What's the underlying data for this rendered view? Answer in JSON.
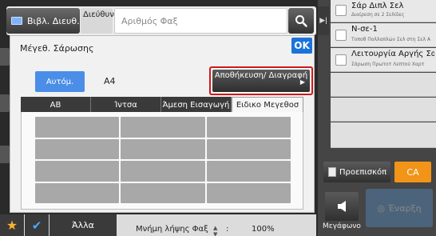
{
  "header": {
    "address_book_label": "Βιβλ. Διευθ.",
    "address_label": "Διεύθυνση",
    "fax_placeholder": "Αριθμός Φαξ"
  },
  "dialog": {
    "title": "Μέγεθ. Σάρωσης",
    "ok_label": "OK",
    "auto_label": "Αυτόμ.",
    "size_value": "A4",
    "save_label": "Αποθήκευση/ Διαγραφή",
    "tabs": [
      {
        "label": "AB",
        "active": false
      },
      {
        "label": "Ίντσα",
        "active": false
      },
      {
        "label": "Άμεση Εισαγωγή",
        "active": false
      },
      {
        "label": "Ειδικο Μεγεθοσ",
        "active": true
      }
    ]
  },
  "bottom": {
    "other_label": "Άλλα",
    "memory_label": "Μνήμη λήψης Φαξ",
    "memory_value": "100%"
  },
  "right_panel": {
    "items": [
      {
        "title": "Σάρ Διπλ Σελ",
        "subtitle": "Διαίρεση σε 2 Σελίδες"
      },
      {
        "title": "Ν-σε-1",
        "subtitle": "Τοποθ Πολλαπλών Σελ στη Σελ Α"
      },
      {
        "title": "Λειτουργία Αργής Σαρωσης",
        "subtitle": "Σάρωση Πρωτοτ Λεπτού Χαρτ"
      }
    ],
    "preview_label": "Προεπισκόπ",
    "ca_label": "CA",
    "speaker_label": "Μεγάφωνο",
    "send_label": "Έναρξη"
  },
  "colors": {
    "accent_blue": "#1b73d9",
    "ca_orange": "#f29418",
    "highlight_red": "#d01818"
  }
}
